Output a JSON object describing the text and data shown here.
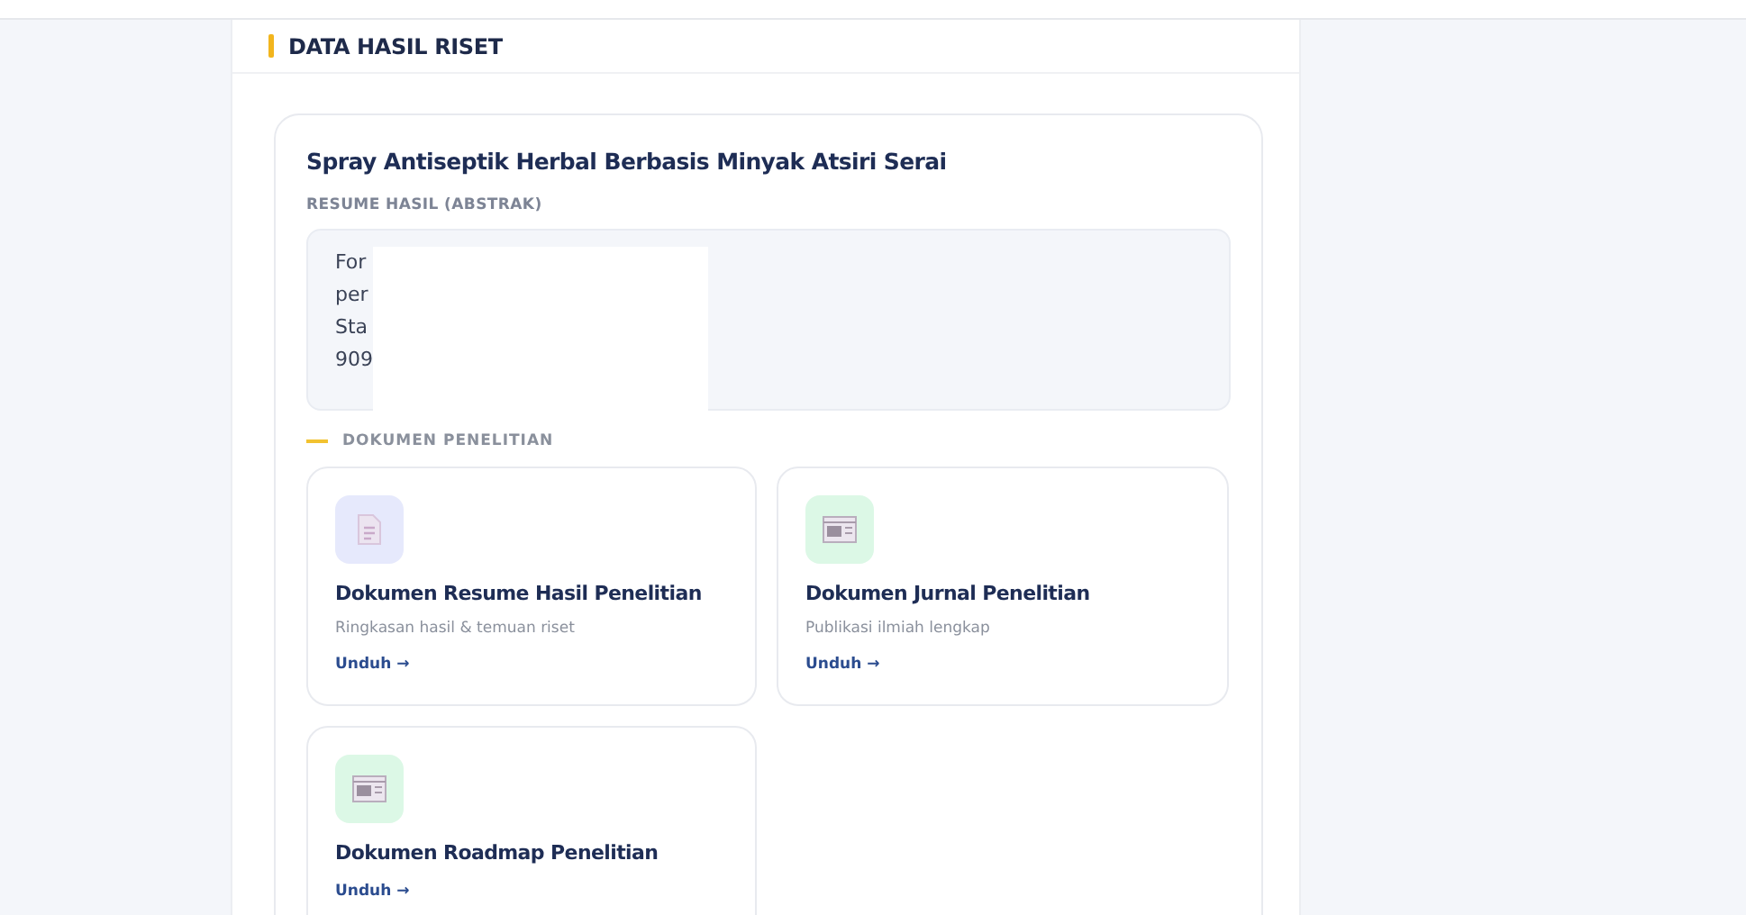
{
  "section_title": "DATA HASIL RISET",
  "research": {
    "title": "Spray Antiseptik Herbal Berbasis Minyak Atsiri Serai",
    "abstract_label": "RESUME HASIL (ABSTRAK)",
    "abstract_lines": [
      "For",
      "per",
      "Sta",
      "909"
    ]
  },
  "documents_label": "DOKUMEN PENELITIAN",
  "documents": [
    {
      "kind": "resume",
      "title": "Dokumen Resume Hasil Penelitian",
      "description": "Ringkasan hasil & temuan riset",
      "link": "Unduh →"
    },
    {
      "kind": "journal",
      "title": "Dokumen Jurnal Penelitian",
      "description": "Publikasi ilmiah lengkap",
      "link": "Unduh →"
    },
    {
      "kind": "journal",
      "title": "Dokumen Roadmap Penelitian",
      "link": "Unduh →"
    }
  ]
}
